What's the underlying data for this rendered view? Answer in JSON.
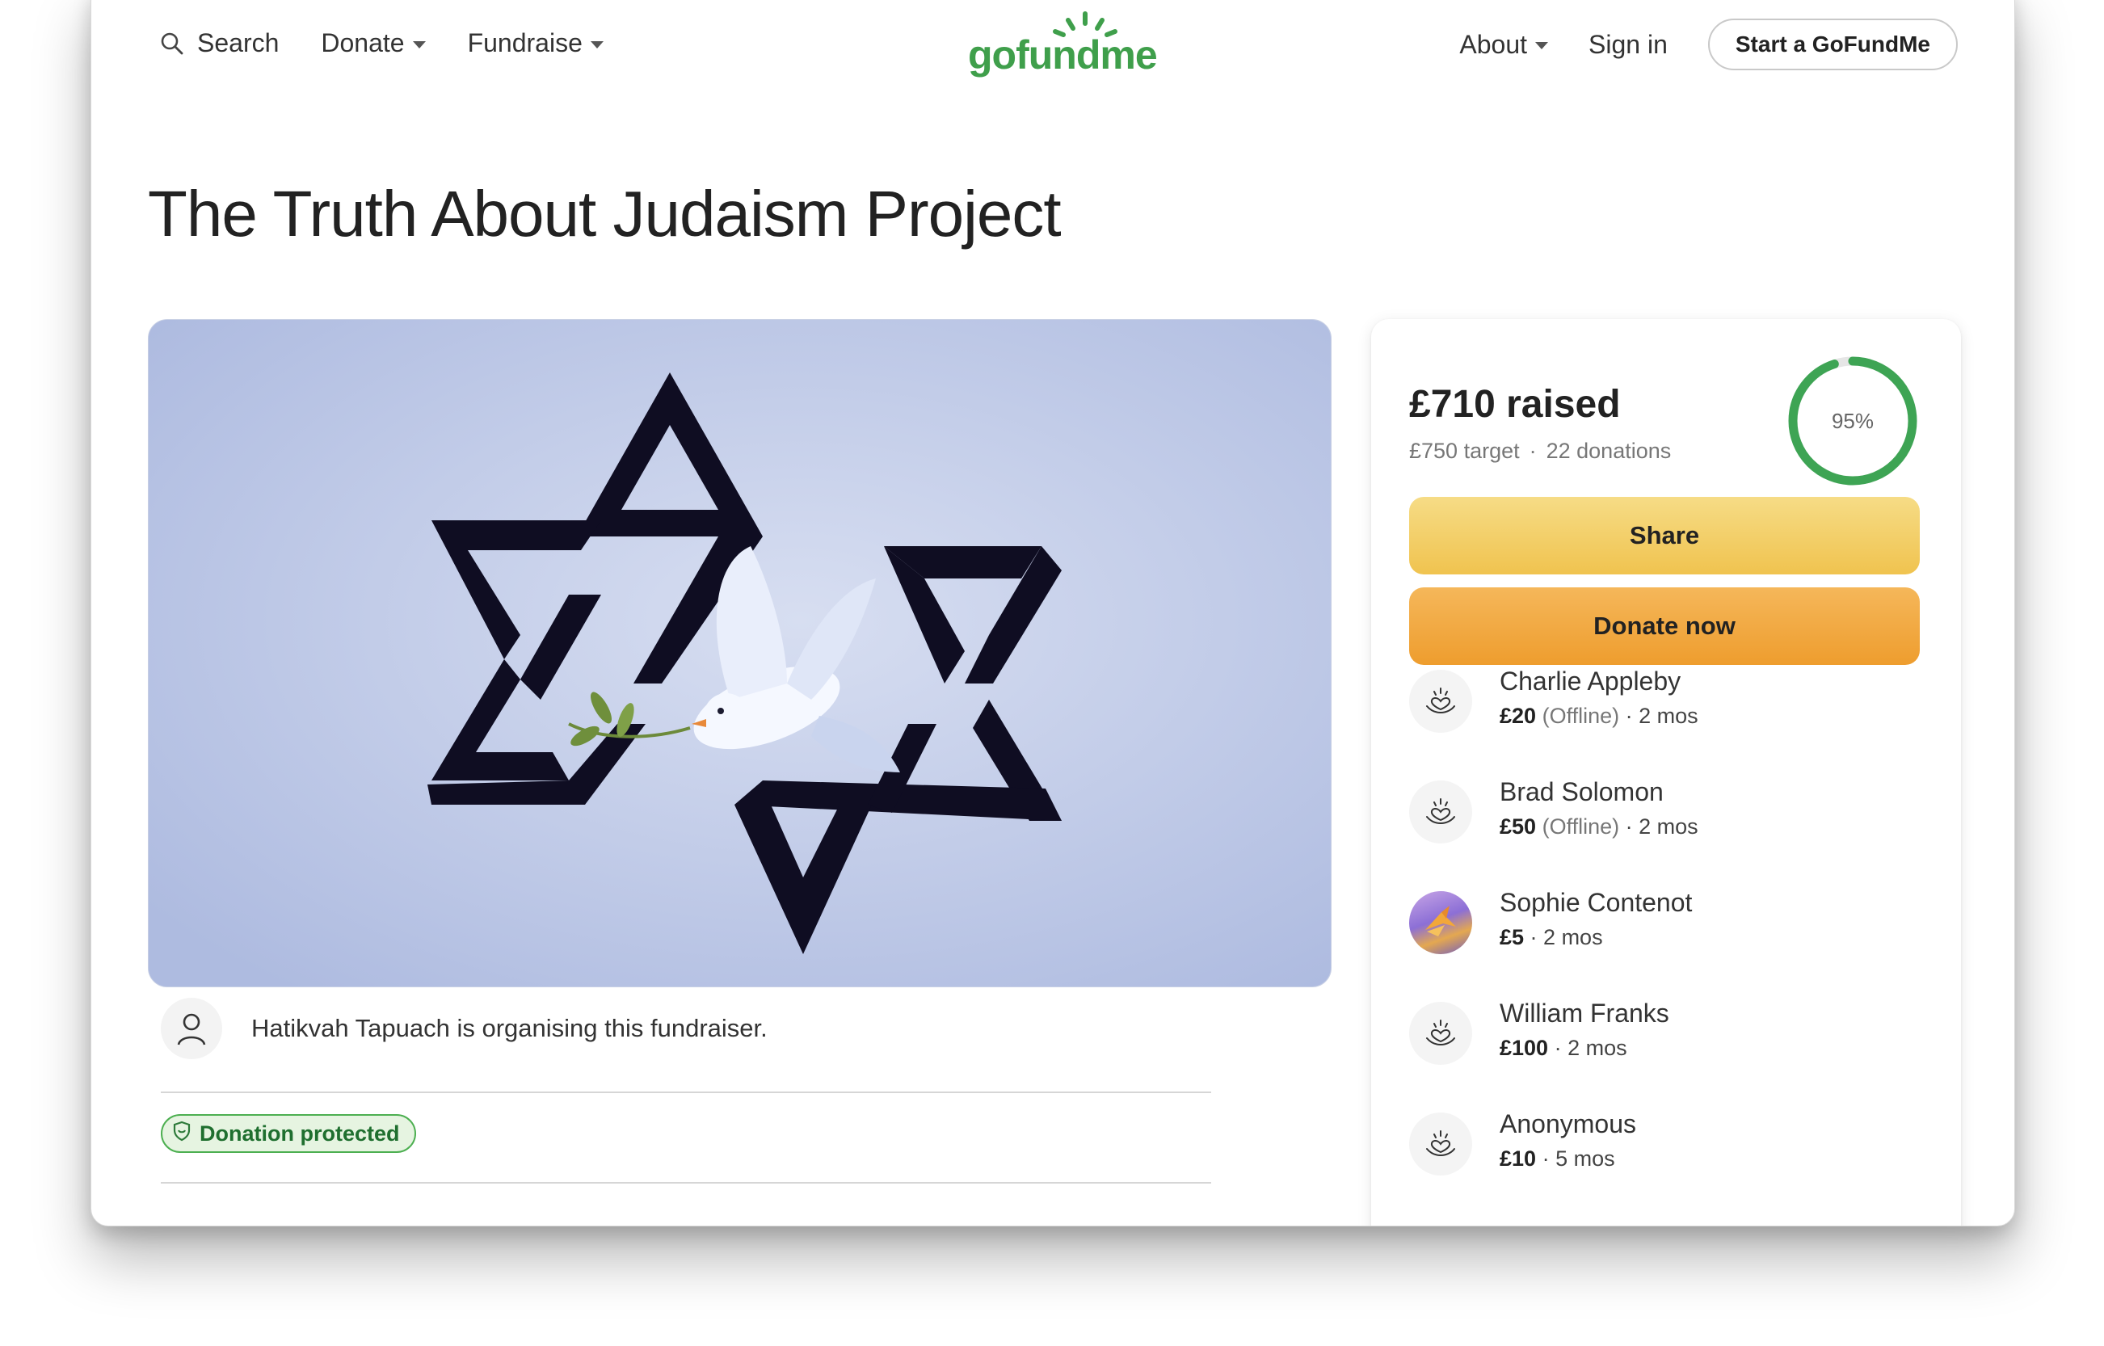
{
  "nav": {
    "search_label": "Search",
    "donate_label": "Donate",
    "fundraise_label": "Fundraise",
    "logo_text": "gofundme",
    "about_label": "About",
    "signin_label": "Sign in",
    "start_label": "Start a GoFundMe"
  },
  "page": {
    "title": "The Truth About Judaism Project"
  },
  "organiser": {
    "text": "Hatikvah Tapuach is organising this fundraiser."
  },
  "badge": {
    "label": "Donation protected"
  },
  "summary": {
    "raised": "£710 raised",
    "target": "£750 target",
    "donations": "22 donations",
    "progress_label": "95%",
    "progress_fraction": 0.95
  },
  "actions": {
    "share_label": "Share",
    "donate_label": "Donate now"
  },
  "donors": [
    {
      "name": "Charlie Appleby",
      "amount": "£20",
      "note": "(Offline)",
      "time": "2 mos"
    },
    {
      "name": "Brad Solomon",
      "amount": "£50",
      "note": "(Offline)",
      "time": "2 mos"
    },
    {
      "name": "Sophie Contenot",
      "amount": "£5",
      "note": "",
      "time": "2 mos"
    },
    {
      "name": "William Franks",
      "amount": "£100",
      "note": "",
      "time": "2 mos"
    },
    {
      "name": "Anonymous",
      "amount": "£10",
      "note": "",
      "time": "5 mos"
    }
  ],
  "colors": {
    "brand_green": "#3f9f4b",
    "share_yellow": "#f0c34f",
    "donate_orange": "#ee9d2e",
    "progress_green": "#3ea454"
  }
}
